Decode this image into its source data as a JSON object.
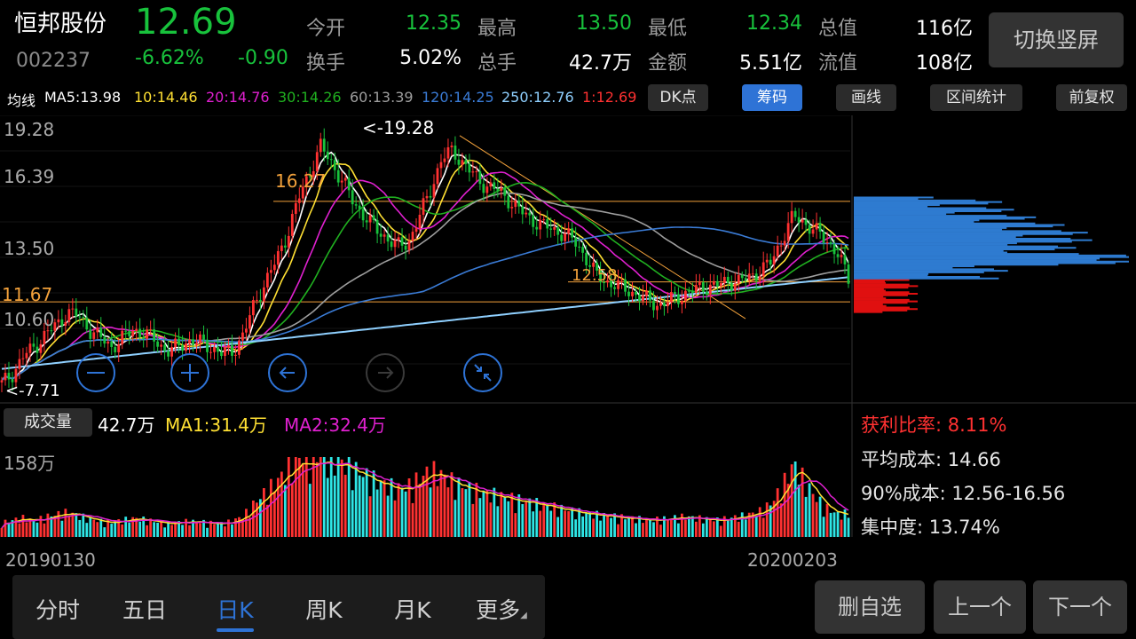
{
  "stock": {
    "name": "恒邦股份",
    "code": "002237",
    "price": "12.69",
    "change_pct": "-6.62%",
    "change": "-0.90"
  },
  "quote": {
    "open_label": "今开",
    "open": "12.35",
    "high_label": "最高",
    "high": "13.50",
    "low_label": "最低",
    "low": "12.34",
    "mcap_label": "总值",
    "mcap": "116亿",
    "turnover_label": "换手",
    "turnover": "5.02%",
    "vol_label": "总手",
    "vol": "42.7万",
    "amount_label": "金额",
    "amount": "5.51亿",
    "float_label": "流值",
    "float": "108亿"
  },
  "switch_button": "切换竖屏",
  "ma_bar": {
    "title": "均线",
    "ma5": "MA5:13.98",
    "ma10": "10:14.46",
    "ma20": "20:14.76",
    "ma30": "30:14.26",
    "ma60": "60:13.39",
    "ma120": "120:14.25",
    "ma250": "250:12.76",
    "ma1": "1:12.69"
  },
  "toolbar": {
    "dk": "DK点",
    "chips": "筹码",
    "draw": "画线",
    "range": "区间统计",
    "adjust": "前复权"
  },
  "chart": {
    "y_labels": [
      "19.28",
      "16.39",
      "13.50",
      "10.60"
    ],
    "hline_high": "16.27",
    "hline_low": "11.67",
    "mid_marker": "12.58",
    "max_note": "<-19.28",
    "min_note": "<-7.71",
    "date_start": "20190130",
    "date_end": "20200203"
  },
  "volume": {
    "button": "成交量",
    "value": "42.7万",
    "ma1": "MA1:31.4万",
    "ma2": "MA2:32.4万",
    "max_label": "158万"
  },
  "chip_stats": {
    "profit": "获利比率: 8.11%",
    "avg_cost": "平均成本: 14.66",
    "cost90": "90%成本: 12.56-16.56",
    "concentration": "集中度: 13.74%"
  },
  "colors": {
    "up": "#ff3131",
    "down": "#18c23c",
    "ma5": "#ffffff",
    "ma10": "#ffe033",
    "ma20": "#e020d0",
    "ma30": "#20b020",
    "ma60": "#9e9e9e",
    "ma120": "#3a7bd5",
    "ma250": "#8fd0ff",
    "ma1": "#ff3131",
    "chips_profit": "#e01010",
    "chips_loss": "#2e7bd0"
  },
  "chart_data": {
    "type": "candlestick",
    "y_ticks": [
      19.28,
      16.39,
      13.5,
      10.6
    ],
    "close_path": [
      7.9,
      8.4,
      9.2,
      9.6,
      10.2,
      10.6,
      11.2,
      11.0,
      10.4,
      10.0,
      9.6,
      10.0,
      10.4,
      10.2,
      9.9,
      9.4,
      9.6,
      9.9,
      9.8,
      9.6,
      9.3,
      9.4,
      10.2,
      11.6,
      12.6,
      13.6,
      14.8,
      16.4,
      17.6,
      18.8,
      18.0,
      17.2,
      16.2,
      15.6,
      15.0,
      14.6,
      14.2,
      14.4,
      15.6,
      16.8,
      18.2,
      18.6,
      18.0,
      17.4,
      17.0,
      16.8,
      16.4,
      15.9,
      15.5,
      15.2,
      15.0,
      14.8,
      14.5,
      13.8,
      12.9,
      12.6,
      12.4,
      12.2,
      11.9,
      11.7,
      11.5,
      11.8,
      12.0,
      12.2,
      12.4,
      12.4,
      12.6,
      12.6,
      12.8,
      13.1,
      13.5,
      14.6,
      15.6,
      15.3,
      14.9,
      14.5,
      13.9,
      12.69
    ],
    "volume_path": [
      25,
      30,
      34,
      28,
      36,
      40,
      44,
      38,
      32,
      28,
      26,
      30,
      33,
      31,
      27,
      24,
      26,
      28,
      27,
      25,
      24,
      28,
      38,
      60,
      80,
      98,
      120,
      140,
      150,
      145,
      138,
      132,
      120,
      110,
      100,
      92,
      86,
      90,
      104,
      118,
      110,
      98,
      90,
      84,
      78,
      74,
      70,
      66,
      62,
      58,
      54,
      50,
      46,
      42,
      40,
      38,
      36,
      34,
      32,
      30,
      32,
      34,
      36,
      34,
      32,
      30,
      33,
      36,
      40,
      46,
      60,
      90,
      130,
      100,
      70,
      52,
      40,
      42.7
    ],
    "ma_values": {
      "MA5": 13.98,
      "MA10": 14.46,
      "MA20": 14.76,
      "MA30": 14.26,
      "MA60": 13.39,
      "MA120": 14.25,
      "MA250": 12.76
    }
  }
}
